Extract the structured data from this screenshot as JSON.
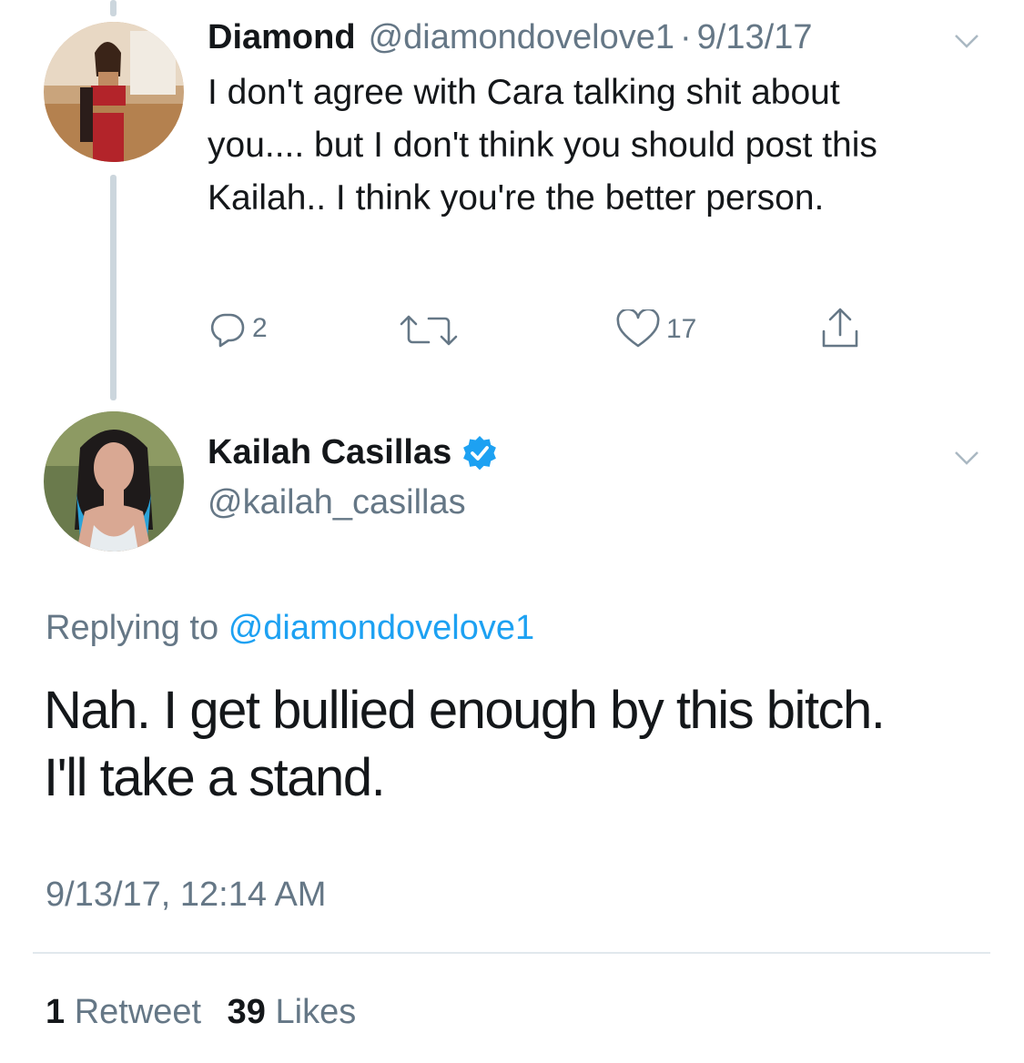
{
  "parent_tweet": {
    "author_name": "Diamond",
    "author_handle": "@diamondovelove1",
    "separator": "·",
    "date": "9/13/17",
    "text": "I don't agree with Cara talking shit about you.... but I don't think you should post this Kailah.. I think you're the better person.",
    "reply_count": "2",
    "retweet_count": "",
    "like_count": "17"
  },
  "main_tweet": {
    "author_name": "Kailah Casillas",
    "author_handle": "@kailah_casillas",
    "verified": true,
    "replying_prefix": "Replying to",
    "replying_to": "@diamondovelove1",
    "text_line1": "Nah. I get bullied enough by this bitch.",
    "text_line2": "I'll take a stand.",
    "timestamp": "9/13/17, 12:14 AM",
    "retweet_count": "1",
    "retweet_label": "Retweet",
    "like_count": "39",
    "like_label": "Likes"
  },
  "icons": {
    "reply": "reply-icon",
    "retweet": "retweet-icon",
    "like": "heart-icon",
    "share": "share-icon",
    "more": "chevron-down-icon",
    "verified": "verified-badge-icon"
  },
  "colors": {
    "link": "#1da1f2",
    "secondary_text": "#657786",
    "thread_line": "#ccd6dd",
    "verified": "#1da1f2"
  }
}
